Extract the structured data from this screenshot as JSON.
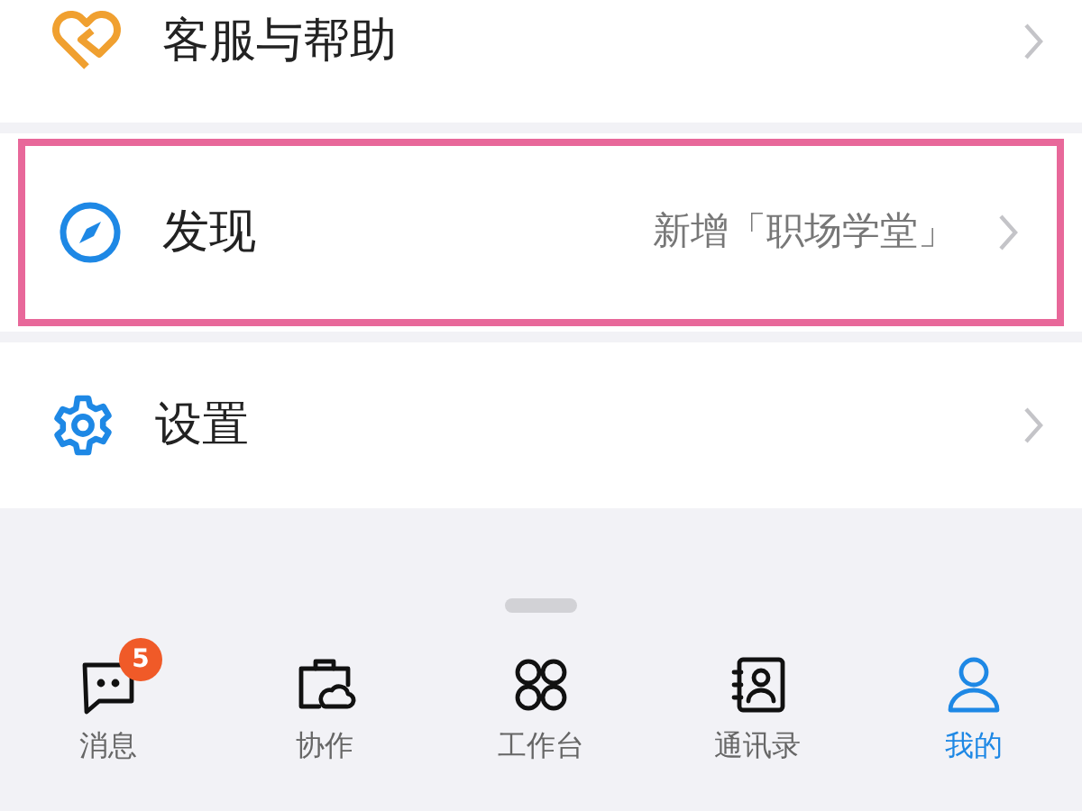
{
  "menu_items": [
    {
      "label": "客服与帮助",
      "highlighted": false
    },
    {
      "label": "发现",
      "detail": "新增「职场学堂」",
      "highlighted": true
    },
    {
      "label": "设置",
      "highlighted": false
    }
  ],
  "tab_bar": [
    {
      "label": "消息",
      "badge": "5",
      "selected": false
    },
    {
      "label": "协作",
      "selected": false
    },
    {
      "label": "工作台",
      "selected": false
    },
    {
      "label": "通讯录",
      "selected": false
    },
    {
      "label": "我的",
      "selected": true
    }
  ]
}
